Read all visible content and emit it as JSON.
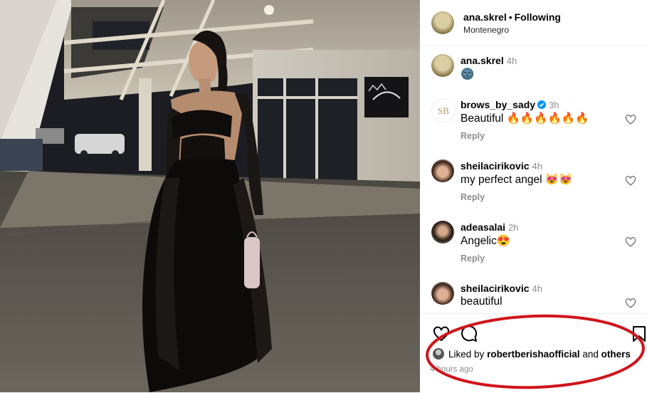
{
  "post": {
    "image_alt": "Woman in black sheer dress standing outdoors at night under building overhang",
    "storefront_sign": "brow logo sign"
  },
  "header": {
    "username": "ana.skrel",
    "separator": "•",
    "follow_status": "Following",
    "location": "Montenegro"
  },
  "comments": [
    {
      "username": "ana.skrel",
      "time": "4h",
      "text": "🌚",
      "reply": "",
      "verified": false
    },
    {
      "username": "brows_by_sady",
      "time": "3h",
      "text": "Beautiful 🔥🔥🔥🔥🔥🔥",
      "reply": "Reply",
      "verified": true
    },
    {
      "username": "sheilacirikovic",
      "time": "4h",
      "text": "my perfect angel 😻😻",
      "reply": "Reply",
      "verified": false
    },
    {
      "username": "adeasalai",
      "time": "2h",
      "text": "Angelic😍",
      "reply": "Reply",
      "verified": false
    },
    {
      "username": "sheilacirikovic",
      "time": "4h",
      "text": "beautiful",
      "reply": "",
      "verified": false
    }
  ],
  "likes": {
    "prefix": "Liked by",
    "user": "robertberishaofficial",
    "middle": "and",
    "suffix": "others"
  },
  "timestamp": "4 hours ago",
  "colors": {
    "annotation_circle": "#d0141c",
    "verified_badge": "#0095f6",
    "muted_text": "#8e8e8e"
  },
  "icons": [
    "heart-icon",
    "comment-icon",
    "bookmark-icon",
    "verified-icon"
  ]
}
